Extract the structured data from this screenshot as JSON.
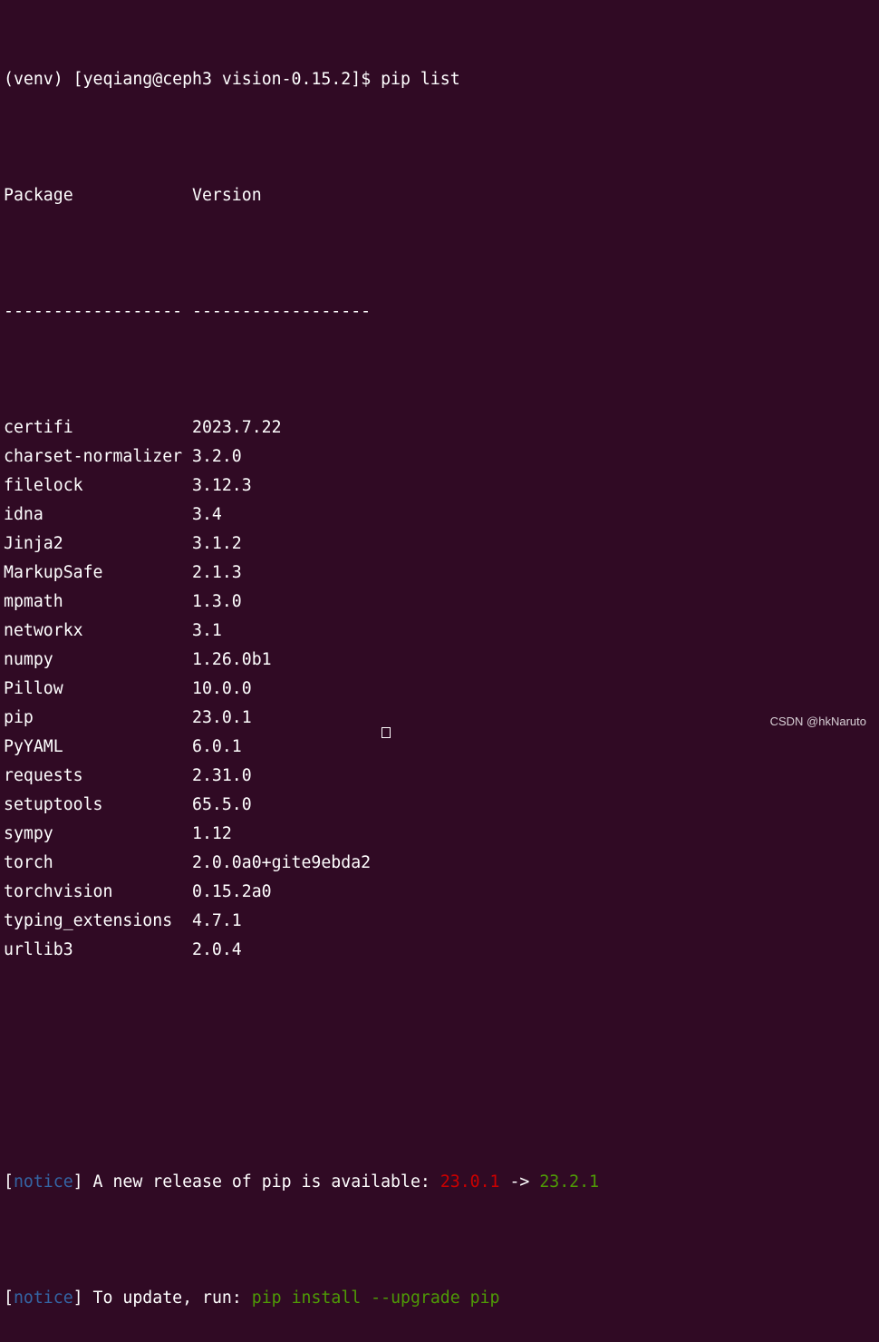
{
  "prompt": {
    "text": "(venv) [yeqiang@ceph3 vision-0.15.2]$ pip list"
  },
  "table": {
    "header_package": "Package",
    "header_version": "Version",
    "sep_package": "------------------",
    "sep_version": "------------------",
    "rows": [
      {
        "name": "certifi",
        "version": "2023.7.22"
      },
      {
        "name": "charset-normalizer",
        "version": "3.2.0"
      },
      {
        "name": "filelock",
        "version": "3.12.3"
      },
      {
        "name": "idna",
        "version": "3.4"
      },
      {
        "name": "Jinja2",
        "version": "3.1.2"
      },
      {
        "name": "MarkupSafe",
        "version": "2.1.3"
      },
      {
        "name": "mpmath",
        "version": "1.3.0"
      },
      {
        "name": "networkx",
        "version": "3.1"
      },
      {
        "name": "numpy",
        "version": "1.26.0b1"
      },
      {
        "name": "Pillow",
        "version": "10.0.0"
      },
      {
        "name": "pip",
        "version": "23.0.1"
      },
      {
        "name": "PyYAML",
        "version": "6.0.1"
      },
      {
        "name": "requests",
        "version": "2.31.0"
      },
      {
        "name": "setuptools",
        "version": "65.5.0"
      },
      {
        "name": "sympy",
        "version": "1.12"
      },
      {
        "name": "torch",
        "version": "2.0.0a0+gite9ebda2"
      },
      {
        "name": "torchvision",
        "version": "0.15.2a0"
      },
      {
        "name": "typing_extensions",
        "version": "4.7.1"
      },
      {
        "name": "urllib3",
        "version": "2.0.4"
      }
    ]
  },
  "notice1": {
    "bracket_open": "[",
    "tag": "notice",
    "bracket_close": "]",
    "text": " A new release of pip is available: ",
    "old_version": "23.0.1",
    "arrow": " -> ",
    "new_version": "23.2.1"
  },
  "notice2": {
    "bracket_open": "[",
    "tag": "notice",
    "bracket_close": "]",
    "text": " To update, run: ",
    "command": "pip install --upgrade pip"
  },
  "watermark": {
    "text": "CSDN @hkNaruto"
  },
  "colors": {
    "background": "#300a24",
    "foreground": "#ffffff",
    "notice_tag": "#3465a4",
    "old_version": "#cc0000",
    "new_version": "#4e9a06"
  }
}
